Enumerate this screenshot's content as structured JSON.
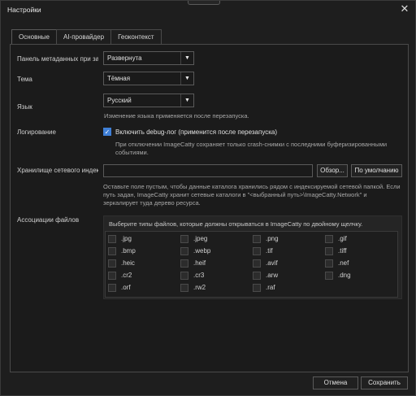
{
  "window": {
    "title": "Настройки"
  },
  "tabs": [
    "Основные",
    "AI-провайдер",
    "Геоконтекст"
  ],
  "metadata_panel": {
    "label": "Панель метаданных при зап",
    "value": "Развернута"
  },
  "theme": {
    "label": "Тема",
    "value": "Тёмная"
  },
  "language": {
    "label": "Язык",
    "value": "Русский",
    "hint": "Изменение языка применяется после перезапуска."
  },
  "logging": {
    "label": "Логирование",
    "checkbox_label": "Включить debug-лог (применится после перезапуска)",
    "checked": true,
    "hint1": "При отключении ImageCatty сохраняет только crash-снимки с последними буферизированными",
    "hint2": "событиями."
  },
  "network_storage": {
    "label": "Хранилище сетевого индекс",
    "value": "",
    "browse_button": "Обзор...",
    "default_button": "По умолчанию",
    "hint1": "Оставьте поле пустым, чтобы данные каталога хранились рядом с индексируемой сетевой папкой. Если",
    "hint2": "путь задан, ImageCatty хранит сетевые каталоги в \"<выбранный путь>\\ImageCatty.Network\" и",
    "hint3": "зеркалирует туда дерево ресурса."
  },
  "file_assoc": {
    "label": "Ассоциации файлов",
    "description": "Выберите типы файлов, которые должны открываться в ImageCatty по двойному щелчку.",
    "types": [
      ".jpg",
      ".jpeg",
      ".png",
      ".gif",
      ".bmp",
      ".webp",
      ".tif",
      ".tiff",
      ".heic",
      ".heif",
      ".avif",
      ".nef",
      ".cr2",
      ".cr3",
      ".arw",
      ".dng",
      ".orf",
      ".rw2",
      ".raf"
    ]
  },
  "footer": {
    "cancel": "Отмена",
    "save": "Сохранить"
  },
  "colors": {
    "accent": "#3f7fd6",
    "background": "#1b1b1b"
  }
}
